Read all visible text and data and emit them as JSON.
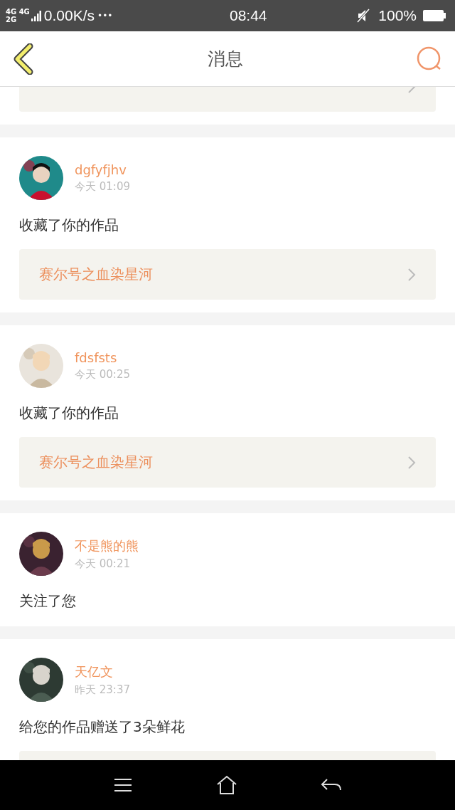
{
  "status_bar": {
    "network_top": "4G 4G",
    "network_bottom": "2G",
    "speed": "0.00K/s",
    "dots": "•••",
    "time": "08:44",
    "battery": "100%"
  },
  "header": {
    "title": "消息"
  },
  "messages": [
    {
      "kind": "cut_work"
    },
    {
      "kind": "message",
      "user": "dgfyfjhv",
      "time": "今天 01:09",
      "action": "收藏了你的作品",
      "work": "赛尔号之血染星河"
    },
    {
      "kind": "message",
      "user": "fdsfsts",
      "time": "今天 00:25",
      "action": "收藏了你的作品",
      "work": "赛尔号之血染星河"
    },
    {
      "kind": "message",
      "user": "不是熊的熊",
      "time": "今天 00:21",
      "action": "关注了您"
    },
    {
      "kind": "message",
      "user": "天亿文",
      "time": "昨天 23:37",
      "action": "给您的作品赠送了3朵鲜花",
      "work_cut": true
    }
  ]
}
